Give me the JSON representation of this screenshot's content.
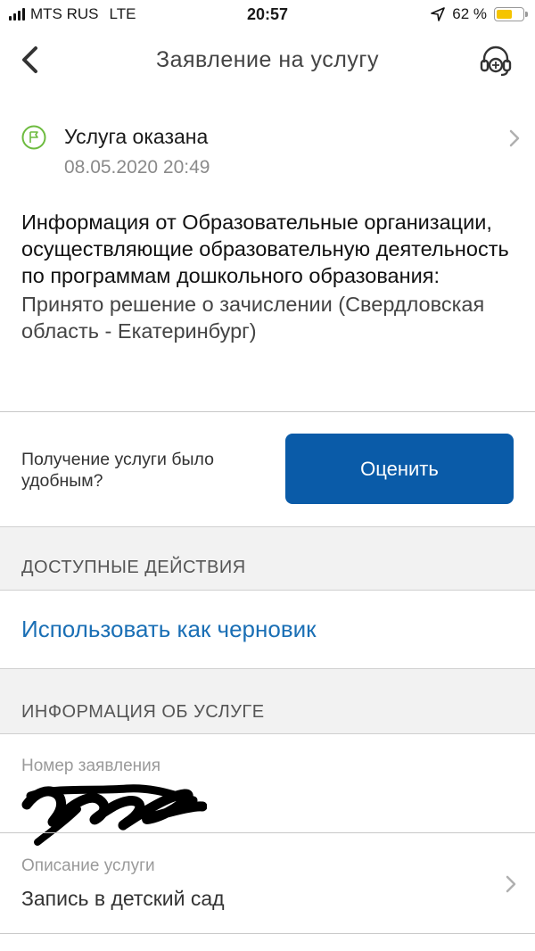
{
  "status_bar": {
    "carrier": "MTS RUS",
    "network": "LTE",
    "time": "20:57",
    "battery": "62 %",
    "battery_level": 0.62
  },
  "nav": {
    "title": "Заявление на услугу",
    "icons": [
      "back-chevron",
      "headset-support"
    ]
  },
  "status": {
    "title": "Услуга оказана",
    "date": "08.05.2020 20:49",
    "icon": "flag-icon",
    "color": "#6dbb3f"
  },
  "info": {
    "heading": "Информация от Образовательные организации, осуществляющие образовательную деятельность по программам дошкольного образования:",
    "text": "Принято решение о зачислении (Свердловская область - Екатеринбург)"
  },
  "rating": {
    "question": "Получение услуги было удобным?",
    "button": "Оценить",
    "button_color": "#0a5ba8"
  },
  "actions": {
    "header": "ДОСТУПНЫЕ ДЕЙСТВИЯ",
    "draft_link": "Использовать как черновик",
    "link_color": "#1a6fb5"
  },
  "service_info": {
    "header": "ИНФОРМАЦИЯ ОБ УСЛУГЕ",
    "number_label": "Номер заявления",
    "description_label": "Описание услуги",
    "description_value": "Запись в детский сад"
  }
}
